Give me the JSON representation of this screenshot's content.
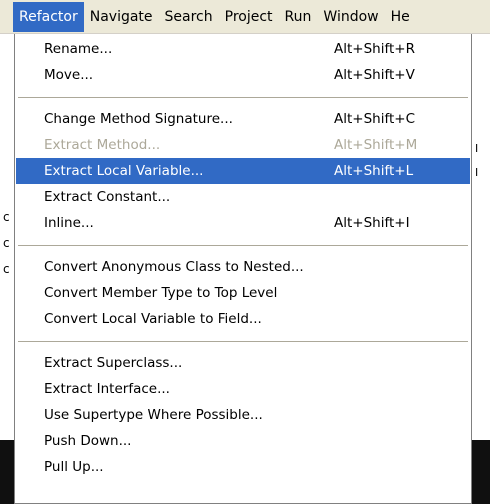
{
  "menubar": {
    "items": [
      {
        "label": "Refactor",
        "active": true
      },
      {
        "label": "Navigate",
        "active": false
      },
      {
        "label": "Search",
        "active": false
      },
      {
        "label": "Project",
        "active": false
      },
      {
        "label": "Run",
        "active": false
      },
      {
        "label": "Window",
        "active": false
      },
      {
        "label": "He",
        "active": false
      }
    ]
  },
  "background": {
    "left_glyphs": [
      "c",
      "c",
      "c"
    ],
    "right_glyphs": [
      "I",
      "I"
    ]
  },
  "refactor_menu": {
    "groups": [
      [
        {
          "label": "Rename...",
          "accel": "Alt+Shift+R",
          "enabled": true,
          "highlighted": false
        },
        {
          "label": "Move...",
          "accel": "Alt+Shift+V",
          "enabled": true,
          "highlighted": false
        }
      ],
      [
        {
          "label": "Change Method Signature...",
          "accel": "Alt+Shift+C",
          "enabled": true,
          "highlighted": false
        },
        {
          "label": "Extract Method...",
          "accel": "Alt+Shift+M",
          "enabled": false,
          "highlighted": false
        },
        {
          "label": "Extract Local Variable...",
          "accel": "Alt+Shift+L",
          "enabled": true,
          "highlighted": true
        },
        {
          "label": "Extract Constant...",
          "accel": "",
          "enabled": true,
          "highlighted": false
        },
        {
          "label": "Inline...",
          "accel": "Alt+Shift+I",
          "enabled": true,
          "highlighted": false
        }
      ],
      [
        {
          "label": "Convert Anonymous Class to Nested...",
          "accel": "",
          "enabled": true,
          "highlighted": false
        },
        {
          "label": "Convert Member Type to Top Level",
          "accel": "",
          "enabled": true,
          "highlighted": false
        },
        {
          "label": "Convert Local Variable to Field...",
          "accel": "",
          "enabled": true,
          "highlighted": false
        }
      ],
      [
        {
          "label": "Extract Superclass...",
          "accel": "",
          "enabled": true,
          "highlighted": false
        },
        {
          "label": "Extract Interface...",
          "accel": "",
          "enabled": true,
          "highlighted": false
        },
        {
          "label": "Use Supertype Where Possible...",
          "accel": "",
          "enabled": true,
          "highlighted": false
        },
        {
          "label": "Push Down...",
          "accel": "",
          "enabled": true,
          "highlighted": false
        },
        {
          "label": "Pull Up...",
          "accel": "",
          "enabled": true,
          "highlighted": false
        }
      ]
    ]
  },
  "colors": {
    "highlight": "#316ac5",
    "disabled_text": "#aca899",
    "menubar_bg": "#ece9d8"
  }
}
